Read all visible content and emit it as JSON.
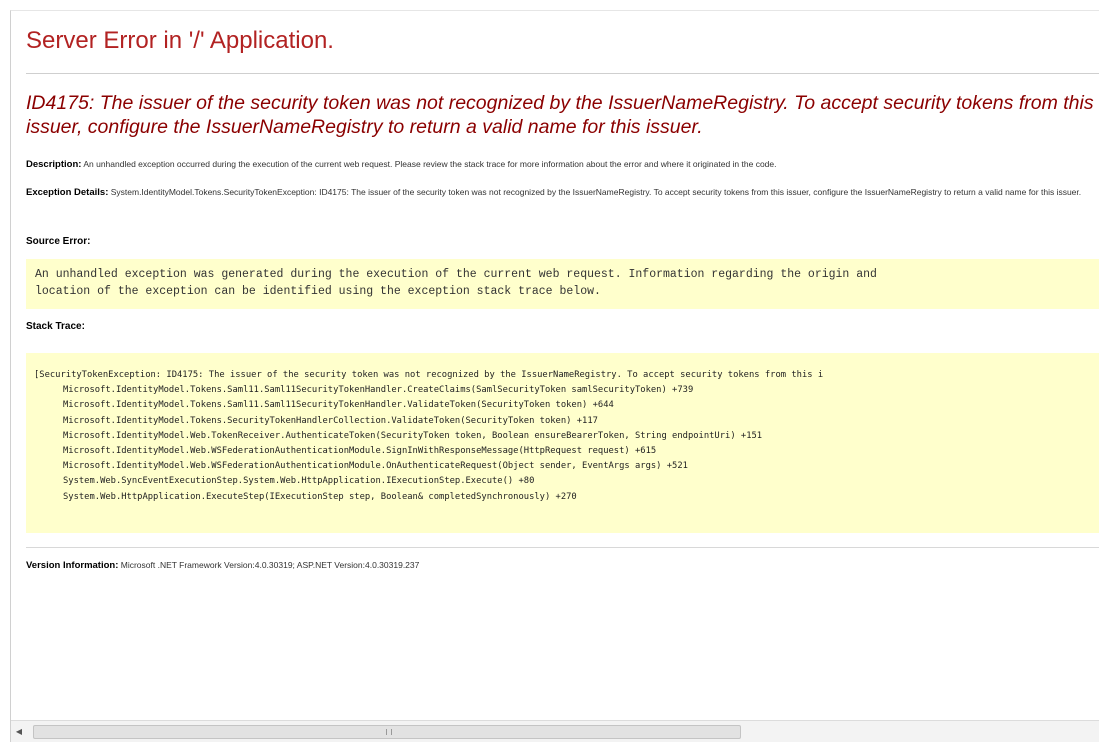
{
  "page": {
    "title": "Server Error in '/' Application.",
    "error_heading": "ID4175: The issuer of the security token was not recognized by the IssuerNameRegistry. To accept security tokens from this issuer, configure the IssuerNameRegistry to return a valid name for this issuer."
  },
  "description": {
    "label": "Description:",
    "text": "An unhandled exception occurred during the execution of the current web request. Please review the stack trace for more information about the error and where it originated in the code."
  },
  "exception_details": {
    "label": "Exception Details:",
    "text": "System.IdentityModel.Tokens.SecurityTokenException: ID4175: The issuer of the security token was not recognized by the IssuerNameRegistry. To accept security tokens from this issuer, configure the IssuerNameRegistry to return a valid name for this issuer."
  },
  "source_error": {
    "label": "Source Error:",
    "lines": [
      "An unhandled exception was generated during the execution of the current web request. Information regarding the origin and",
      "location of the exception can be identified using the exception stack trace below."
    ]
  },
  "stack_trace": {
    "label": "Stack Trace:",
    "lines": [
      "[SecurityTokenException: ID4175: The issuer of the security token was not recognized by the IssuerNameRegistry. To accept security tokens from this i",
      "Microsoft.IdentityModel.Tokens.Saml11.Saml11SecurityTokenHandler.CreateClaims(SamlSecurityToken samlSecurityToken) +739",
      "Microsoft.IdentityModel.Tokens.Saml11.Saml11SecurityTokenHandler.ValidateToken(SecurityToken token) +644",
      "Microsoft.IdentityModel.Tokens.SecurityTokenHandlerCollection.ValidateToken(SecurityToken token) +117",
      "Microsoft.IdentityModel.Web.TokenReceiver.AuthenticateToken(SecurityToken token, Boolean ensureBearerToken, String endpointUri) +151",
      "Microsoft.IdentityModel.Web.WSFederationAuthenticationModule.SignInWithResponseMessage(HttpRequest request) +615",
      "Microsoft.IdentityModel.Web.WSFederationAuthenticationModule.OnAuthenticateRequest(Object sender, EventArgs args) +521",
      "System.Web.SyncEventExecutionStep.System.Web.HttpApplication.IExecutionStep.Execute() +80",
      "System.Web.HttpApplication.ExecuteStep(IExecutionStep step, Boolean& completedSynchronously) +270"
    ]
  },
  "version_info": {
    "label": "Version Information:",
    "text": "Microsoft .NET Framework Version:4.0.30319; ASP.NET Version:4.0.30319.237"
  },
  "scrollbar": {
    "left_arrow_icon": "triangle-left"
  }
}
